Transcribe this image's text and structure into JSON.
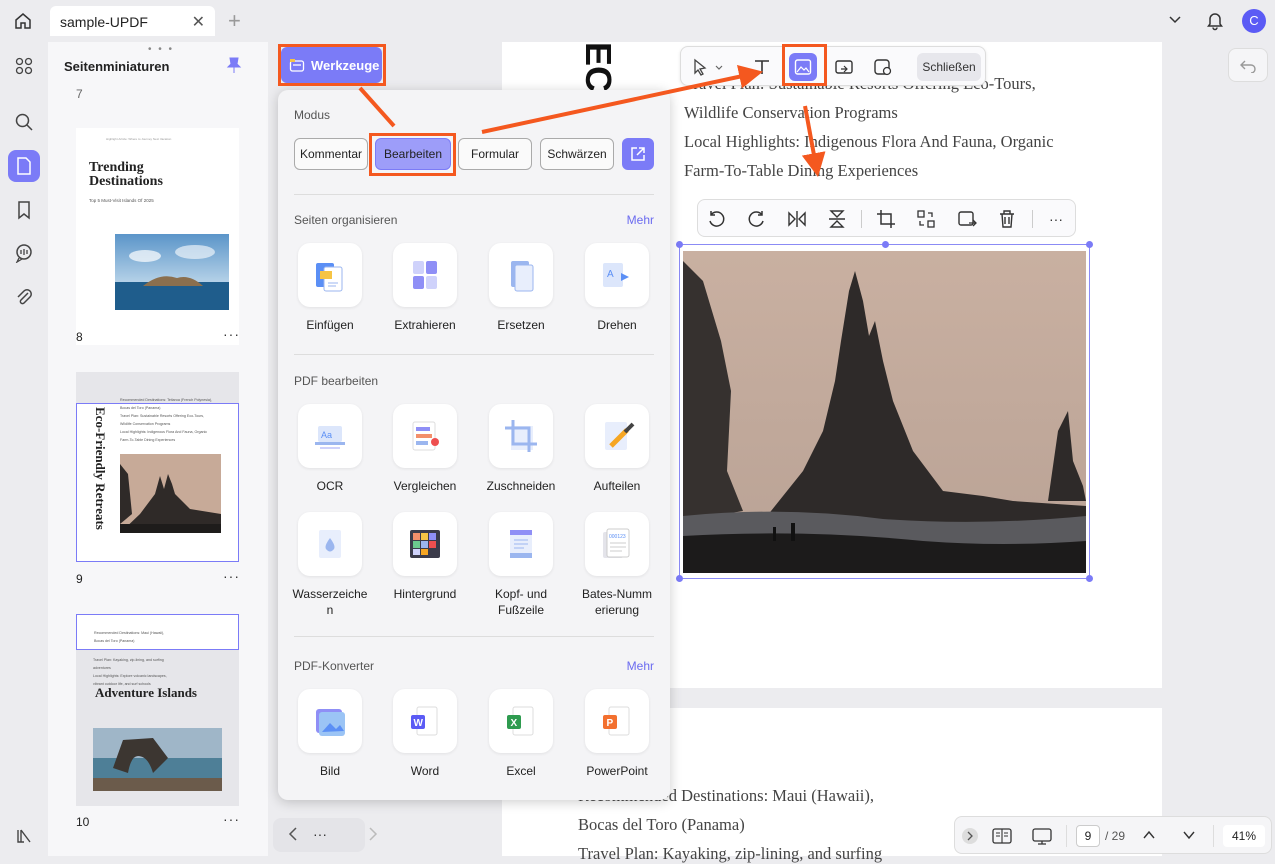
{
  "tabs": {
    "doc_title": "sample-UPDF",
    "close": "✕",
    "add": "+",
    "avatar_letter": "C"
  },
  "sidebar": {
    "title": "Seitenminiaturen",
    "thumbnails": [
      {
        "page": "8",
        "title": "Trending Destinations",
        "subtitle": "Top 5 Must-Visit Islands Of 2025",
        "header": "Highlight Article: Where to Journey Next Vacation"
      },
      {
        "page": "9",
        "title": "Eco-Friendly Retreats",
        "lines": [
          "Recommended Destinations: Tetiaroa (French Polynesia),",
          "Bocas del Toro (Panama)",
          "Travel Plan: Sustainable Resorts Offering Eco-Tours,",
          "Wildlife Conservation Programs",
          "Local Highlights: Indigenous Flora And Fauna, Organic",
          "Farm-To-Table Dining Experiences"
        ]
      },
      {
        "page": "10",
        "title": "Adventure Islands",
        "lines": [
          "Recommended Destinations: Maui (Hawaii),",
          "Bocas del Toro (Panama)",
          "Travel Plan: Kayaking, zip-lining, and surfing",
          "adventures",
          "Local Highlights: Explore volcanic landscapes,",
          "vibrant outdoor life, and surf schools"
        ]
      }
    ],
    "more": "···"
  },
  "werkzeuge": {
    "label": "Werkzeuge"
  },
  "popup": {
    "modus_title": "Modus",
    "modes": [
      "Kommentar",
      "Bearbeiten",
      "Formular",
      "Schwärzen"
    ],
    "organize_title": "Seiten organisieren",
    "organize_more": "Mehr",
    "organize_tools": [
      "Einfügen",
      "Extrahieren",
      "Ersetzen",
      "Drehen"
    ],
    "edit_title": "PDF bearbeiten",
    "edit_tools": [
      "OCR",
      "Vergleichen",
      "Zuschneiden",
      "Aufteilen",
      "Wasserzeiche\nn",
      "Hintergrund",
      "Kopf- und\nFußzeile",
      "Bates-Numm\nerierung"
    ],
    "convert_title": "PDF-Konverter",
    "convert_more": "Mehr",
    "convert_tools": [
      "Bild",
      "Word",
      "Excel",
      "PowerPoint"
    ]
  },
  "toolbar": {
    "close_label": "Schließen"
  },
  "page1": {
    "lines": [
      "Travel Plan: Sustainable Resorts Offering Eco-Tours,",
      "Wildlife Conservation Programs",
      "Local Highlights: Indigenous Flora And Fauna, Organic",
      "Farm-To-Table Dining Experiences"
    ],
    "vertical_text": "ECO"
  },
  "page2": {
    "lines": [
      "Recommended Destinations: Maui (Hawaii),",
      "Bocas del Toro (Panama)",
      "Travel Plan: Kayaking, zip-lining, and surfing"
    ]
  },
  "bottom": {
    "page_current": "9",
    "page_total": "/ 29",
    "zoom": "41%",
    "more": "···"
  },
  "colors": {
    "accent": "#7b7bf7",
    "highlight": "#f4581f"
  }
}
